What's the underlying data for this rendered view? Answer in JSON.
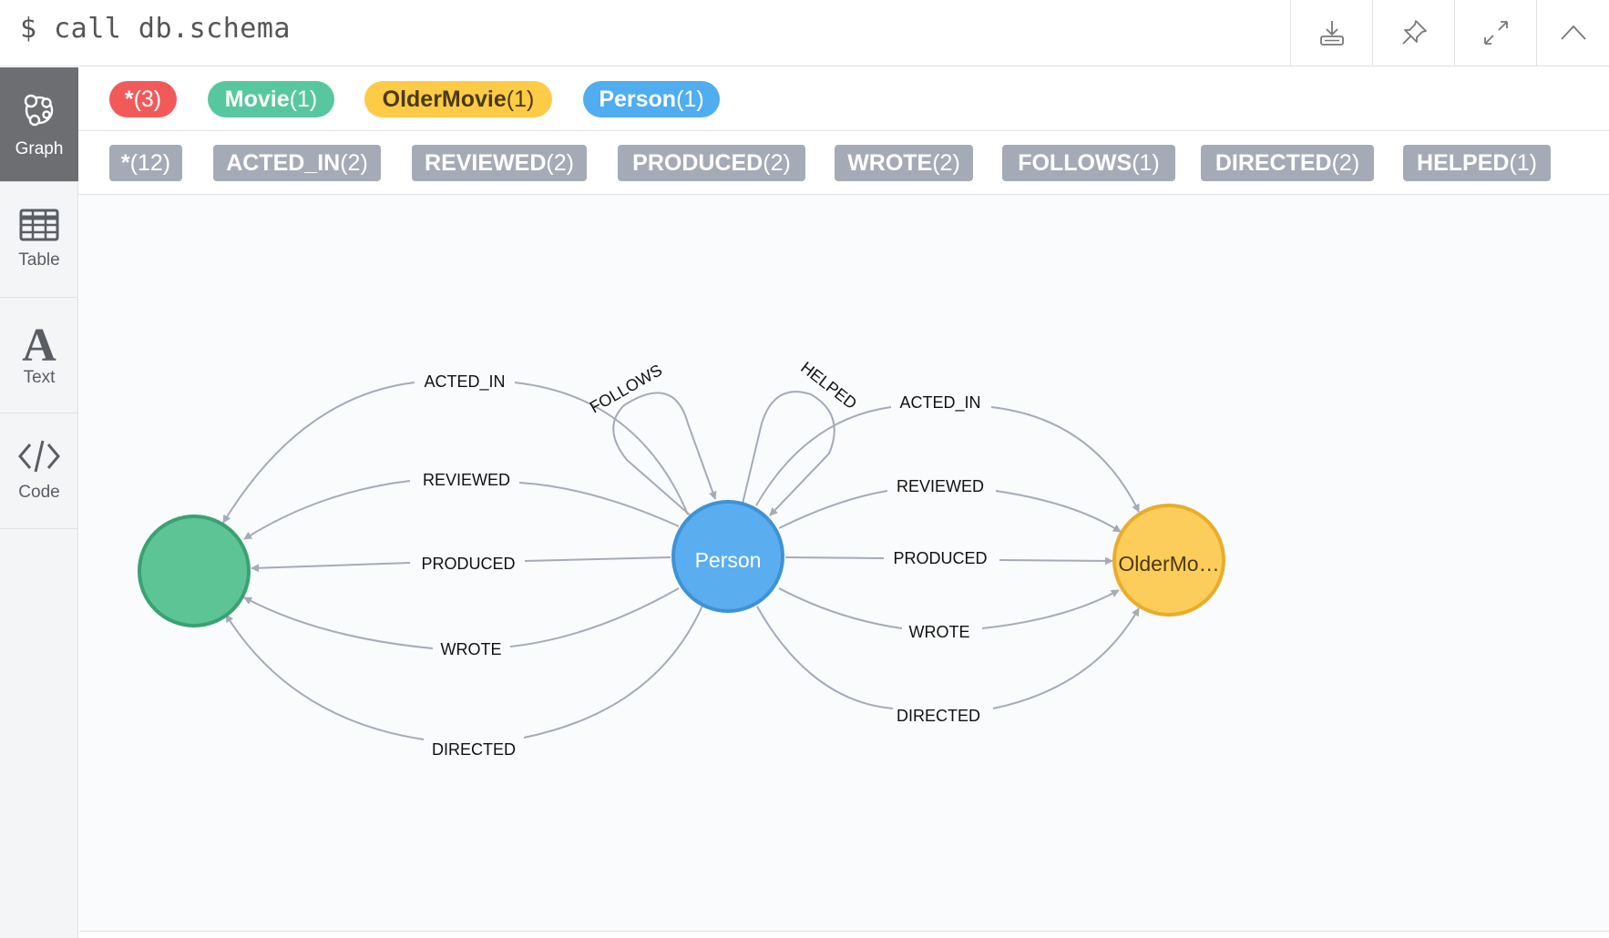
{
  "command": "$ call db.schema",
  "toolbar": {
    "download_icon": "download-icon",
    "pin_icon": "pin-icon",
    "expand_icon": "expand-icon",
    "collapse_icon": "chevron-up-icon"
  },
  "sidebar": {
    "items": [
      {
        "label": "Graph",
        "icon": "graph-icon",
        "active": true
      },
      {
        "label": "Table",
        "icon": "table-icon"
      },
      {
        "label": "Text",
        "icon": "text-icon"
      },
      {
        "label": "Code",
        "icon": "code-icon"
      }
    ]
  },
  "node_labels": [
    {
      "name": "*",
      "count": "(3)",
      "color": "#f25a5a"
    },
    {
      "name": "Movie",
      "count": "(1)",
      "color": "#57c7a0"
    },
    {
      "name": "OlderMovie",
      "count": "(1)",
      "color": "#fecb47"
    },
    {
      "name": "Person",
      "count": "(1)",
      "color": "#4fadf0"
    }
  ],
  "rel_types": [
    {
      "name": "*",
      "count": "(12)"
    },
    {
      "name": "ACTED_IN",
      "count": "(2)"
    },
    {
      "name": "REVIEWED",
      "count": "(2)"
    },
    {
      "name": "PRODUCED",
      "count": "(2)"
    },
    {
      "name": "WROTE",
      "count": "(2)"
    },
    {
      "name": "FOLLOWS",
      "count": "(1)"
    },
    {
      "name": "DIRECTED",
      "count": "(2)"
    },
    {
      "name": "HELPED",
      "count": "(1)"
    }
  ],
  "graph": {
    "nodes": {
      "movie": {
        "label": "",
        "color": "#5dc595",
        "stroke": "#3aa272"
      },
      "person": {
        "label": "Person",
        "color": "#5aaef0",
        "stroke": "#3d93d6"
      },
      "older": {
        "label": "OlderMo…",
        "color": "#fdcd5b",
        "stroke": "#e8ad2a"
      }
    },
    "left_edges": [
      "ACTED_IN",
      "REVIEWED",
      "PRODUCED",
      "WROTE",
      "DIRECTED"
    ],
    "right_edges": [
      "ACTED_IN",
      "REVIEWED",
      "PRODUCED",
      "WROTE",
      "DIRECTED"
    ],
    "self_loops": [
      "FOLLOWS",
      "HELPED"
    ]
  }
}
